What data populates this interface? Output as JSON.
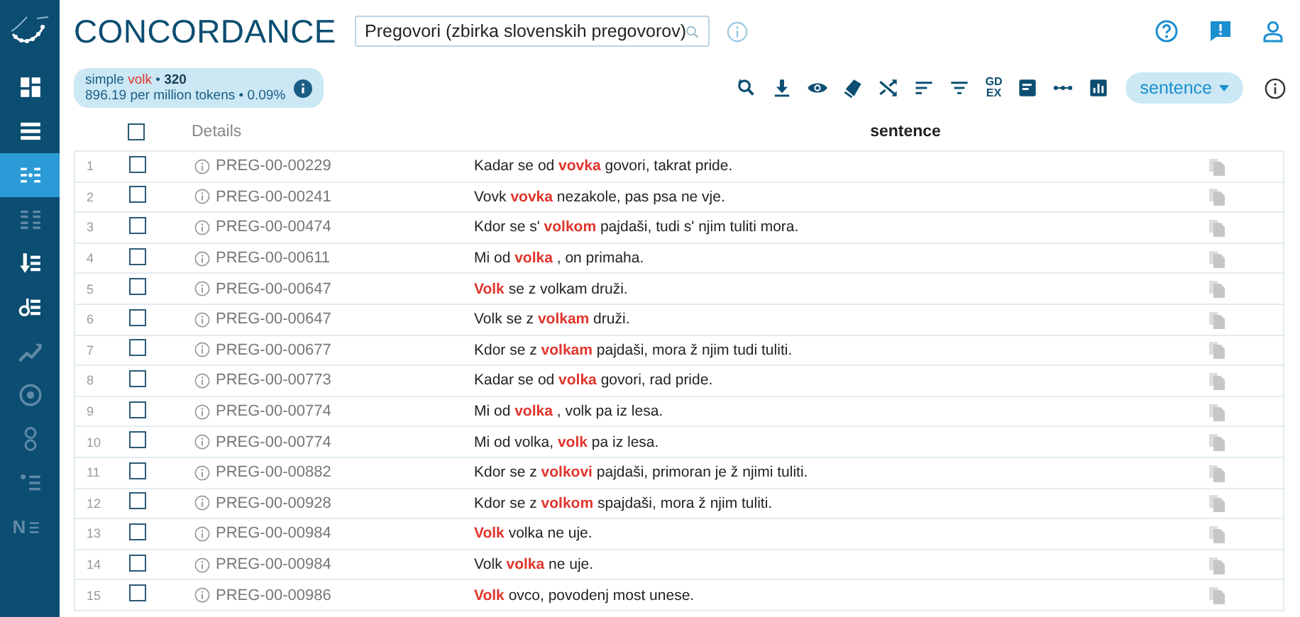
{
  "sidebar": {
    "items": [
      {
        "kind": "dashboard",
        "selected": false,
        "disabled": false
      },
      {
        "kind": "list",
        "selected": false,
        "disabled": false
      },
      {
        "kind": "concordance",
        "selected": true,
        "disabled": false
      },
      {
        "kind": "parallel",
        "selected": false,
        "disabled": true
      },
      {
        "kind": "sort-down",
        "selected": false,
        "disabled": false
      },
      {
        "kind": "sort-keyword",
        "selected": false,
        "disabled": false
      },
      {
        "kind": "trend",
        "selected": false,
        "disabled": true
      },
      {
        "kind": "target",
        "selected": false,
        "disabled": true
      },
      {
        "kind": "double-circle",
        "selected": false,
        "disabled": true
      },
      {
        "kind": "dot-list",
        "selected": false,
        "disabled": true
      },
      {
        "kind": "n-list",
        "label": "N",
        "selected": false,
        "disabled": true
      }
    ]
  },
  "header": {
    "title": "CONCORDANCE",
    "corpus_search": {
      "value": "Pregovori (zbirka slovenskih pregovorov)"
    }
  },
  "summary": {
    "query_type": "simple",
    "query": "volk",
    "hits": "320",
    "separator": "•",
    "per_million": "896.19 per million tokens",
    "percent": "0.09%"
  },
  "toolbar": {
    "tools": [
      {
        "kind": "search-again"
      },
      {
        "kind": "download"
      },
      {
        "kind": "eye"
      },
      {
        "kind": "ticket"
      },
      {
        "kind": "shuffle"
      },
      {
        "kind": "sort"
      },
      {
        "kind": "filter"
      },
      {
        "kind": "gdex",
        "label": "GD EX"
      },
      {
        "kind": "document"
      },
      {
        "kind": "dots"
      },
      {
        "kind": "chart"
      }
    ],
    "view_dropdown": "sentence"
  },
  "table": {
    "columns": [
      "Details",
      "sentence"
    ],
    "select_all_checked": false,
    "rows": [
      {
        "number": "1",
        "checked": false,
        "details": "PREG-00-00229",
        "sentence": "Kadar se od **vovka** govori, takrat pride."
      },
      {
        "number": "2",
        "checked": false,
        "details": "PREG-00-00241",
        "sentence": "Vovk **vovka** nezakole, pas psa ne vje."
      },
      {
        "number": "3",
        "checked": false,
        "details": "PREG-00-00474",
        "sentence": "Kdor se s' **volkom** pajdaši, tudi s' njim tuliti mora."
      },
      {
        "number": "4",
        "checked": false,
        "details": "PREG-00-00611",
        "sentence": "Mi od **volka** , on primaha."
      },
      {
        "number": "5",
        "checked": false,
        "details": "PREG-00-00647",
        "sentence": "**Volk** se z volkam druži."
      },
      {
        "number": "6",
        "checked": false,
        "details": "PREG-00-00647",
        "sentence": "Volk se z **volkam** druži."
      },
      {
        "number": "7",
        "checked": false,
        "details": "PREG-00-00677",
        "sentence": "Kdor se z **volkam** pajdaši, mora ž njim tudi tuliti."
      },
      {
        "number": "8",
        "checked": false,
        "details": "PREG-00-00773",
        "sentence": "Kadar se od **volka** govori, rad pride."
      },
      {
        "number": "9",
        "checked": false,
        "details": "PREG-00-00774",
        "sentence": "Mi od **volka** , volk pa iz lesa."
      },
      {
        "number": "10",
        "checked": false,
        "details": "PREG-00-00774",
        "sentence": "Mi od volka, **volk** pa iz lesa."
      },
      {
        "number": "11",
        "checked": false,
        "details": "PREG-00-00882",
        "sentence": "Kdor se z **volkovi** pajdaši, primoran je ž njimi tuliti."
      },
      {
        "number": "12",
        "checked": false,
        "details": "PREG-00-00928",
        "sentence": "Kdor se z **volkom** spajdaši, mora ž njim tuliti."
      },
      {
        "number": "13",
        "checked": false,
        "details": "PREG-00-00984",
        "sentence": "**Volk** volka ne uje."
      },
      {
        "number": "14",
        "checked": false,
        "details": "PREG-00-00984",
        "sentence": "Volk **volka** ne uje."
      },
      {
        "number": "15",
        "checked": false,
        "details": "PREG-00-00986",
        "sentence": "**Volk** ovco, povodenj most unese."
      }
    ]
  }
}
